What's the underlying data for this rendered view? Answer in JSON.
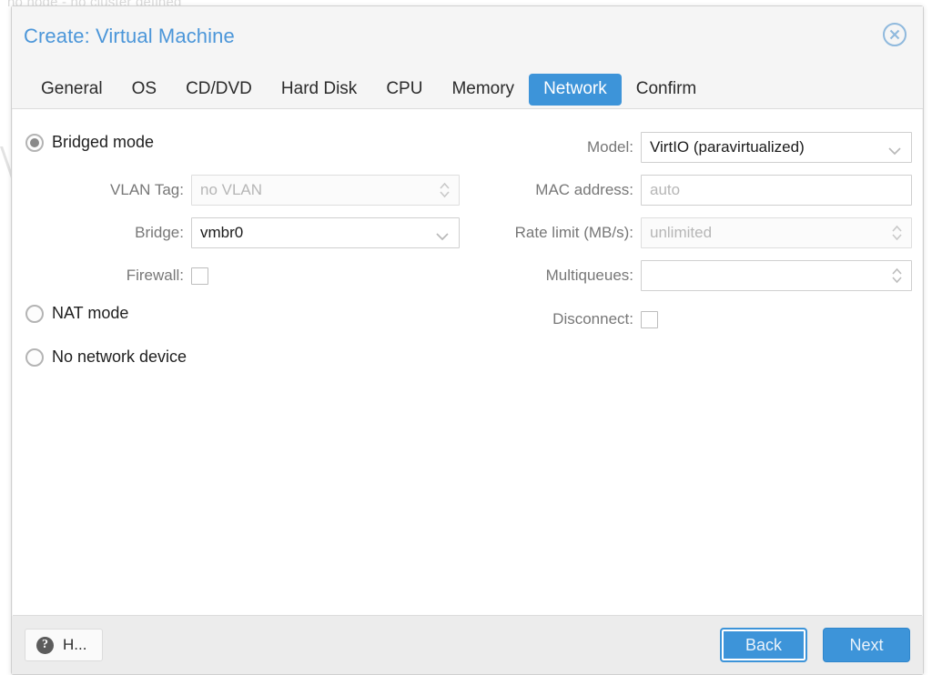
{
  "background": {
    "status_text": "no node - no cluster defined"
  },
  "dialog": {
    "title": "Create: Virtual Machine",
    "close_icon": "close-circle-icon",
    "tabs": [
      {
        "label": "General",
        "active": false
      },
      {
        "label": "OS",
        "active": false
      },
      {
        "label": "CD/DVD",
        "active": false
      },
      {
        "label": "Hard Disk",
        "active": false
      },
      {
        "label": "CPU",
        "active": false
      },
      {
        "label": "Memory",
        "active": false
      },
      {
        "label": "Network",
        "active": true
      },
      {
        "label": "Confirm",
        "active": false
      }
    ],
    "accent_color": "#3d94d9",
    "title_color": "#4b96d9"
  },
  "network": {
    "modes": [
      {
        "label": "Bridged mode",
        "selected": true
      },
      {
        "label": "NAT mode",
        "selected": false
      },
      {
        "label": "No network device",
        "selected": false
      }
    ],
    "left_fields": {
      "vlan_tag": {
        "label": "VLAN Tag:",
        "value": "",
        "placeholder": "no VLAN",
        "disabled": true
      },
      "bridge": {
        "label": "Bridge:",
        "value": "vmbr0",
        "disabled": false
      },
      "firewall": {
        "label": "Firewall:",
        "checked": false
      }
    },
    "right_fields": {
      "model": {
        "label": "Model:",
        "value": "VirtIO (paravirtualized)"
      },
      "mac_address": {
        "label": "MAC address:",
        "value": "",
        "placeholder": "auto"
      },
      "rate_limit": {
        "label": "Rate limit (MB/s):",
        "value": "",
        "placeholder": "unlimited",
        "disabled": true
      },
      "multiqueues": {
        "label": "Multiqueues:",
        "value": "",
        "placeholder": ""
      },
      "disconnect": {
        "label": "Disconnect:",
        "checked": false
      }
    }
  },
  "footer": {
    "help_label": "H...",
    "help_icon": "question-mark-icon",
    "back_label": "Back",
    "next_label": "Next"
  }
}
